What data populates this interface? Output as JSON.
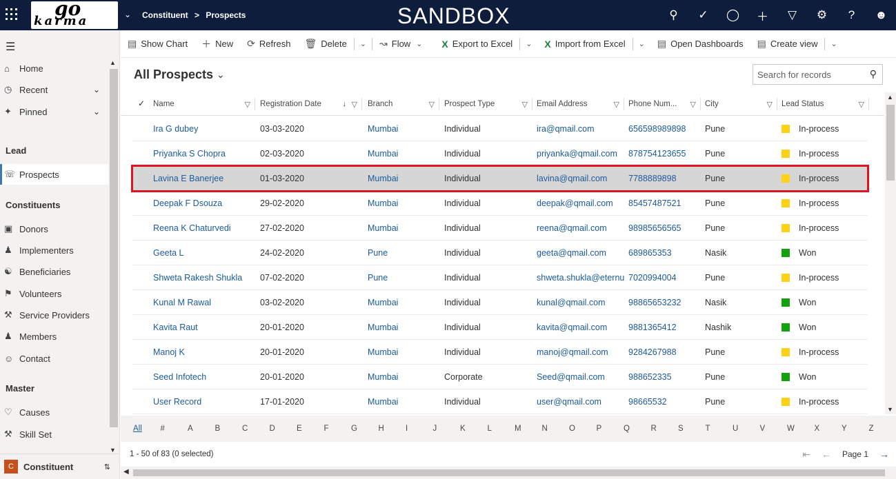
{
  "topbar": {
    "logo_top": "go",
    "logo_bottom": "karma",
    "breadcrumb": [
      "Constituent",
      ">",
      "Prospects"
    ],
    "environment": "SANDBOX",
    "icons": [
      "search-icon",
      "task-icon",
      "lightbulb-icon",
      "plus-icon",
      "filter-icon",
      "gear-icon",
      "help-icon",
      "user-icon"
    ]
  },
  "sidebar": {
    "items": [
      {
        "label": "Home",
        "icon": "home-icon"
      },
      {
        "label": "Recent",
        "icon": "clock-icon",
        "chevron": true
      },
      {
        "label": "Pinned",
        "icon": "pin-icon",
        "chevron": true
      }
    ],
    "group_lead": "Lead",
    "lead_items": [
      {
        "label": "Prospects",
        "icon": "prospect-icon"
      }
    ],
    "group_constituents": "Constituents",
    "constituent_items": [
      {
        "label": "Donors",
        "icon": "donor-icon"
      },
      {
        "label": "Implementers",
        "icon": "implementer-icon"
      },
      {
        "label": "Beneficiaries",
        "icon": "beneficiary-icon"
      },
      {
        "label": "Volunteers",
        "icon": "volunteer-icon"
      },
      {
        "label": "Service Providers",
        "icon": "service-provider-icon"
      },
      {
        "label": "Members",
        "icon": "members-icon"
      },
      {
        "label": "Contact",
        "icon": "contact-icon"
      }
    ],
    "group_master": "Master",
    "master_items": [
      {
        "label": "Causes",
        "icon": "causes-icon"
      },
      {
        "label": "Skill Set",
        "icon": "skillset-icon"
      }
    ],
    "area_badge": "C",
    "area_name": "Constituent"
  },
  "commands": {
    "show_chart": "Show Chart",
    "new": "New",
    "refresh": "Refresh",
    "delete": "Delete",
    "flow": "Flow",
    "export_excel": "Export to Excel",
    "import_excel": "Import from Excel",
    "open_dashboards": "Open Dashboards",
    "create_view": "Create view"
  },
  "view": {
    "title": "All Prospects",
    "search_placeholder": "Search for records"
  },
  "columns": [
    "Name",
    "Registration Date",
    "Branch",
    "Prospect Type",
    "Email Address",
    "Phone Num...",
    "City",
    "Lead Status"
  ],
  "rows": [
    {
      "name": "Ira G dubey",
      "date": "03-03-2020",
      "branch": "Mumbai",
      "type": "Individual",
      "email": "ira@qmail.com",
      "phone": "656598989898",
      "city": "Pune",
      "status": "In-process",
      "status_color": "#fcd116"
    },
    {
      "name": "Priyanka S Chopra",
      "date": "02-03-2020",
      "branch": "Mumbai",
      "type": "Individual",
      "email": "priyanka@qmail.com",
      "phone": "878754123655",
      "city": "Pune",
      "status": "In-process",
      "status_color": "#fcd116"
    },
    {
      "name": "Lavina E Banerjee",
      "date": "01-03-2020",
      "branch": "Mumbai",
      "type": "Individual",
      "email": "lavina@qmail.com",
      "phone": "7788889898",
      "city": "Pune",
      "status": "In-process",
      "status_color": "#fcd116",
      "selected": true
    },
    {
      "name": "Deepak F Dsouza",
      "date": "29-02-2020",
      "branch": "Mumbai",
      "type": "Individual",
      "email": "deepak@qmail.com",
      "phone": "85457487521",
      "city": "Pune",
      "status": "In-process",
      "status_color": "#fcd116"
    },
    {
      "name": "Reena K Chaturvedi",
      "date": "27-02-2020",
      "branch": "Mumbai",
      "type": "Individual",
      "email": "reena@qmail.com",
      "phone": "98985656565",
      "city": "Pune",
      "status": "In-process",
      "status_color": "#fcd116"
    },
    {
      "name": "Geeta L",
      "date": "24-02-2020",
      "branch": "Pune",
      "type": "Individual",
      "email": "geeta@qmail.com",
      "phone": "689865353",
      "city": "Nasik",
      "status": "Won",
      "status_color": "#13a10e"
    },
    {
      "name": "Shweta Rakesh Shukla",
      "date": "07-02-2020",
      "branch": "Pune",
      "type": "Individual",
      "email": "shweta.shukla@eternu",
      "phone": "7020994004",
      "city": "Pune",
      "status": "In-process",
      "status_color": "#fcd116"
    },
    {
      "name": "Kunal M Rawal",
      "date": "03-02-2020",
      "branch": "Mumbai",
      "type": "Individual",
      "email": "kunal@qmail.com",
      "phone": "98865653232",
      "city": "Nasik",
      "status": "Won",
      "status_color": "#13a10e"
    },
    {
      "name": "Kavita Raut",
      "date": "20-01-2020",
      "branch": "Mumbai",
      "type": "Individual",
      "email": "kavita@qmail.com",
      "phone": "9881365412",
      "city": "Nashik",
      "status": "Won",
      "status_color": "#13a10e"
    },
    {
      "name": "Manoj K",
      "date": "20-01-2020",
      "branch": "Mumbai",
      "type": "Individual",
      "email": "manoj@qmail.com",
      "phone": "9284267988",
      "city": "Pune",
      "status": "In-process",
      "status_color": "#fcd116"
    },
    {
      "name": "Seed Infotech",
      "date": "20-01-2020",
      "branch": "Mumbai",
      "type": "Corporate",
      "email": "Seed@qmail.com",
      "phone": "988652335",
      "city": "Pune",
      "status": "Won",
      "status_color": "#13a10e"
    },
    {
      "name": "User Record",
      "date": "17-01-2020",
      "branch": "Mumbai",
      "type": "Individual",
      "email": "user@qmail.com",
      "phone": "98665532",
      "city": "Pune",
      "status": "In-process",
      "status_color": "#fcd116"
    }
  ],
  "alphabet": [
    "All",
    "#",
    "A",
    "B",
    "C",
    "D",
    "E",
    "F",
    "G",
    "H",
    "I",
    "J",
    "K",
    "L",
    "M",
    "N",
    "O",
    "P",
    "Q",
    "R",
    "S",
    "T",
    "U",
    "V",
    "W",
    "X",
    "Y",
    "Z"
  ],
  "footer": {
    "count": "1 - 50 of 83 (0 selected)",
    "page": "Page 1"
  }
}
